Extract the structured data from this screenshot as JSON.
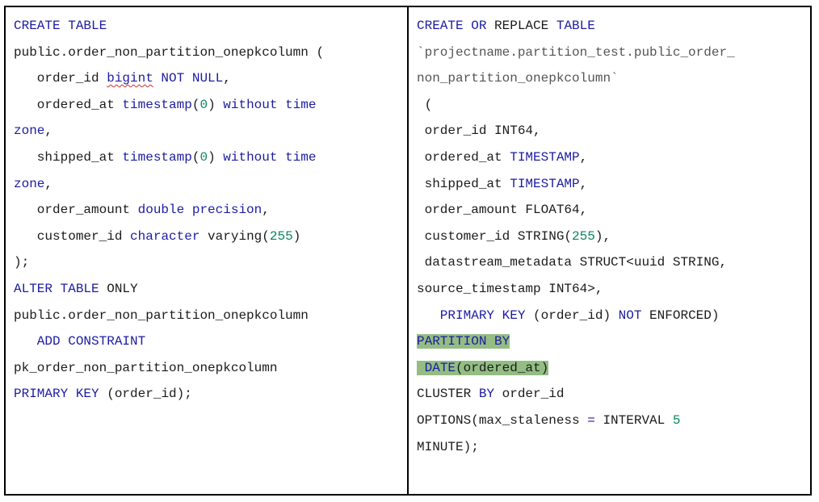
{
  "left_cell": {
    "lines": [
      [
        {
          "t": "CREATE TABLE",
          "c": "kw"
        }
      ],
      [
        {
          "t": "public.order_non_partition_onepkcolumn (",
          "c": ""
        }
      ],
      [
        {
          "t": "   order_id ",
          "c": ""
        },
        {
          "t": "bigint",
          "c": "kw spell"
        },
        {
          "t": " NOT NULL",
          "c": "kw"
        },
        {
          "t": ",",
          "c": ""
        }
      ],
      [
        {
          "t": "   ordered_at ",
          "c": ""
        },
        {
          "t": "timestamp",
          "c": "kw"
        },
        {
          "t": "(",
          "c": ""
        },
        {
          "t": "0",
          "c": "num"
        },
        {
          "t": ") ",
          "c": ""
        },
        {
          "t": "without time",
          "c": "kw"
        }
      ],
      [
        {
          "t": "zone",
          "c": "kw"
        },
        {
          "t": ",",
          "c": ""
        }
      ],
      [
        {
          "t": "   shipped_at ",
          "c": ""
        },
        {
          "t": "timestamp",
          "c": "kw"
        },
        {
          "t": "(",
          "c": ""
        },
        {
          "t": "0",
          "c": "num"
        },
        {
          "t": ") ",
          "c": ""
        },
        {
          "t": "without time",
          "c": "kw"
        }
      ],
      [
        {
          "t": "zone",
          "c": "kw"
        },
        {
          "t": ",",
          "c": ""
        }
      ],
      [
        {
          "t": "   order_amount ",
          "c": ""
        },
        {
          "t": "double precision",
          "c": "kw"
        },
        {
          "t": ",",
          "c": ""
        }
      ],
      [
        {
          "t": "   customer_id ",
          "c": ""
        },
        {
          "t": "character",
          "c": "kw"
        },
        {
          "t": " varying(",
          "c": ""
        },
        {
          "t": "255",
          "c": "num"
        },
        {
          "t": ")",
          "c": ""
        }
      ],
      [
        {
          "t": ");",
          "c": ""
        }
      ],
      [
        {
          "t": "ALTER TABLE",
          "c": "kw"
        },
        {
          "t": " ONLY",
          "c": ""
        }
      ],
      [
        {
          "t": "public.order_non_partition_onepkcolumn",
          "c": ""
        }
      ],
      [
        {
          "t": "   ADD CONSTRAINT",
          "c": "kw"
        }
      ],
      [
        {
          "t": "pk_order_non_partition_onepkcolumn",
          "c": ""
        }
      ],
      [
        {
          "t": "PRIMARY KEY",
          "c": "kw"
        },
        {
          "t": " (order_id);",
          "c": ""
        }
      ]
    ]
  },
  "right_cell": {
    "lines": [
      [
        {
          "t": "CREATE OR",
          "c": "kw"
        },
        {
          "t": " REPLACE ",
          "c": ""
        },
        {
          "t": "TABLE",
          "c": "kw"
        }
      ],
      [
        {
          "t": "`projectname.partition_test.public_order_",
          "c": "str"
        }
      ],
      [
        {
          "t": "non_partition_onepkcolumn`",
          "c": "str"
        }
      ],
      [
        {
          "t": " (",
          "c": ""
        }
      ],
      [
        {
          "t": " order_id INT64,",
          "c": ""
        }
      ],
      [
        {
          "t": " ordered_at ",
          "c": ""
        },
        {
          "t": "TIMESTAMP",
          "c": "kw"
        },
        {
          "t": ",",
          "c": ""
        }
      ],
      [
        {
          "t": " shipped_at ",
          "c": ""
        },
        {
          "t": "TIMESTAMP",
          "c": "kw"
        },
        {
          "t": ",",
          "c": ""
        }
      ],
      [
        {
          "t": " order_amount FLOAT64,",
          "c": ""
        }
      ],
      [
        {
          "t": " customer_id STRING(",
          "c": ""
        },
        {
          "t": "255",
          "c": "num"
        },
        {
          "t": "),",
          "c": ""
        }
      ],
      [
        {
          "t": " datastream_metadata STRUCT<uuid STRING,",
          "c": ""
        }
      ],
      [
        {
          "t": "source_timestamp INT64>,",
          "c": ""
        }
      ],
      [
        {
          "t": "   PRIMARY KEY",
          "c": "kw"
        },
        {
          "t": " (order_id) ",
          "c": ""
        },
        {
          "t": "NOT",
          "c": "kw"
        },
        {
          "t": " ENFORCED)",
          "c": ""
        }
      ],
      [
        {
          "t": "PARTITION BY",
          "c": "kw hl"
        }
      ],
      [
        {
          "t": " ",
          "c": "hl"
        },
        {
          "t": "DATE",
          "c": "kw hl"
        },
        {
          "t": "(ordered_at)",
          "c": "hl"
        }
      ],
      [
        {
          "t": "CLUSTER ",
          "c": ""
        },
        {
          "t": "BY",
          "c": "kw"
        },
        {
          "t": " order_id",
          "c": ""
        }
      ],
      [
        {
          "t": "OPTIONS(max_staleness ",
          "c": ""
        },
        {
          "t": "=",
          "c": "kw"
        },
        {
          "t": " INTERVAL ",
          "c": ""
        },
        {
          "t": "5",
          "c": "num"
        }
      ],
      [
        {
          "t": "MINUTE);",
          "c": ""
        }
      ]
    ]
  }
}
